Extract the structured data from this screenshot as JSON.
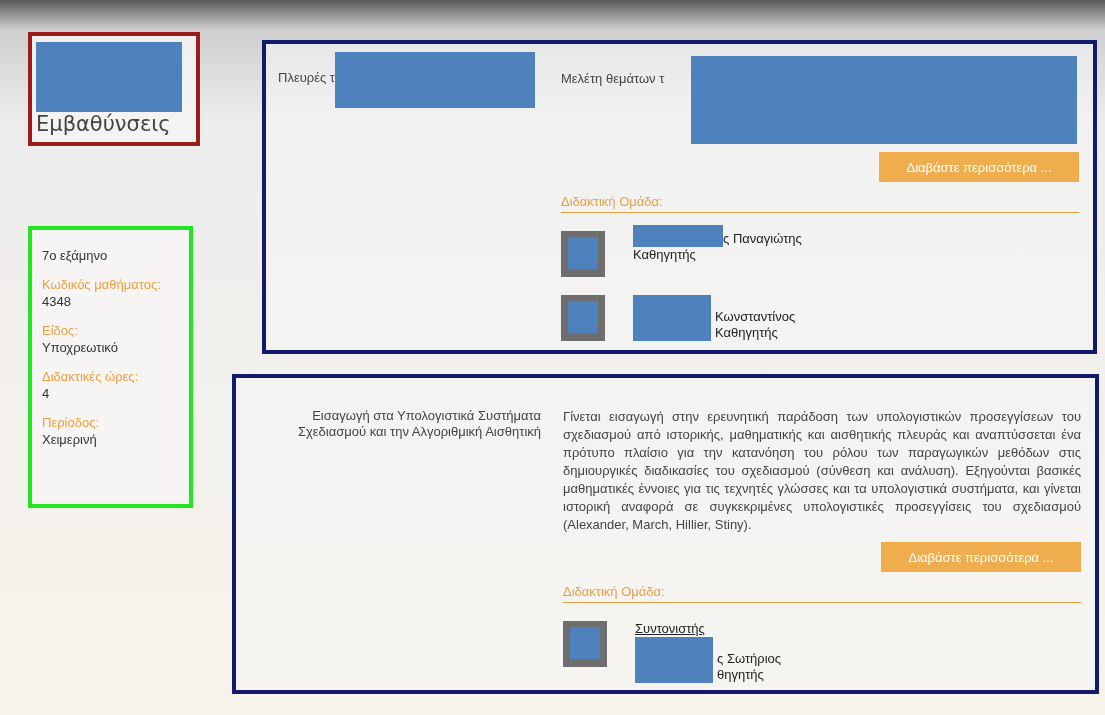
{
  "sidebar": {
    "title_parts": [
      {
        "kind": "redaction"
      },
      {
        "kind": "text",
        "text": "Εμβαθύνσεις"
      }
    ],
    "semester": "7ο εξάμηνο",
    "fields": [
      {
        "label": "Κωδικός μαθήματος:",
        "value": "4348"
      },
      {
        "label": "Είδος:",
        "value": "Υποχρεωτικό"
      },
      {
        "label": "Διδακτικές ώρες:",
        "value": "4"
      },
      {
        "label": "Περίοδος:",
        "value": "Χειμερινή"
      }
    ]
  },
  "courses": [
    {
      "title_parts": [
        {
          "kind": "text",
          "text": "Πλευρές τ"
        },
        {
          "kind": "redaction"
        }
      ],
      "description_parts": [
        {
          "kind": "text",
          "text": "Μελέτη  θεμάτων  τ"
        },
        {
          "kind": "redaction"
        }
      ],
      "read_more": "Διαβάστε περισσότερα ...",
      "team_heading": "Διδακτική Ομάδα:",
      "members": [
        {
          "kind": "namehidden",
          "name": "ς Παναγιώτης",
          "title": "Καθηγητής"
        },
        {
          "kind": "bothhidden",
          "name": "Κωνσταντίνος",
          "title": "Καθηγητής"
        }
      ]
    },
    {
      "title_parts": [
        {
          "kind": "text",
          "text": "Εισαγωγή στα Υπολογιστικά Συστήματα Σχεδιασμού και την Αλγοριθμική Αισθητική"
        }
      ],
      "description_parts": [
        {
          "kind": "text",
          "text": "Γίνεται εισαγωγή στην ερευνητική παράδοση των υπολογιστικών προσεγγίσεων του σχεδιασμού από ιστορικής, μαθηματικής και αισθητικής πλευράς και αναπτύσσεται ένα πρότυπο πλαίσιο για την κατανόηση του ρόλου των παραγωγικών μεθόδων στις δημιουργικές διαδικασίες του σχεδιασμού (σύνθεση και ανάλυση). Εξηγούνται βασικές μαθηματικές έννοιες για τις τεχνητές γλώσσες και τα υπολογιστικά συστήματα, και γίνεται ιστορική αναφορά σε συγκεκριμένες υπολογιστικές προσεγγίσεις του σχεδιασμού (Alexander, March, Hillier, Stiny)."
        }
      ],
      "read_more": "Διαβάστε περισσότερα ...",
      "team_heading": "Διδακτική Ομάδα:",
      "members": [
        {
          "role": "Συντονιστής",
          "kind": "bothhidden",
          "name": "ς Σωτήριος",
          "title": "θηγητής"
        }
      ]
    }
  ]
}
